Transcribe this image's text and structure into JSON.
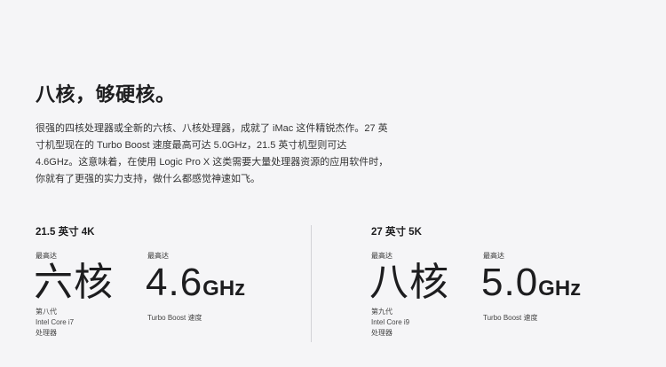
{
  "headline": "八核，够硬核。",
  "body": "很强的四核处理器或全新的六核、八核处理器，成就了 iMac 这件精锐杰作。27 英寸机型现在的 Turbo Boost 速度最高可达 5.0GHz，21.5 英寸机型则可达 4.6GHz。这意味着，在使用 Logic Pro X 这类需要大量处理器资源的应用软件时，你就有了更强的实力支持，做什么都感觉神速如飞。",
  "specs": [
    {
      "model": "21.5 英寸 4K",
      "cores": {
        "eyebrow": "最高达",
        "value": "六核",
        "lines": [
          "第八代",
          "Intel Core i7",
          "处理器"
        ]
      },
      "speed": {
        "eyebrow": "最高达",
        "value": "4.6",
        "unit": "GHz",
        "caption": "Turbo Boost 速度"
      }
    },
    {
      "model": "27 英寸 5K",
      "cores": {
        "eyebrow": "最高达",
        "value": "八核",
        "lines": [
          "第九代",
          "Intel Core i9",
          "处理器"
        ]
      },
      "speed": {
        "eyebrow": "最高达",
        "value": "5.0",
        "unit": "GHz",
        "caption": "Turbo Boost 速度"
      }
    }
  ],
  "colors": {
    "background": "#f5f5f7",
    "text": "#1d1d1f",
    "divider": "#d2d2d7"
  }
}
